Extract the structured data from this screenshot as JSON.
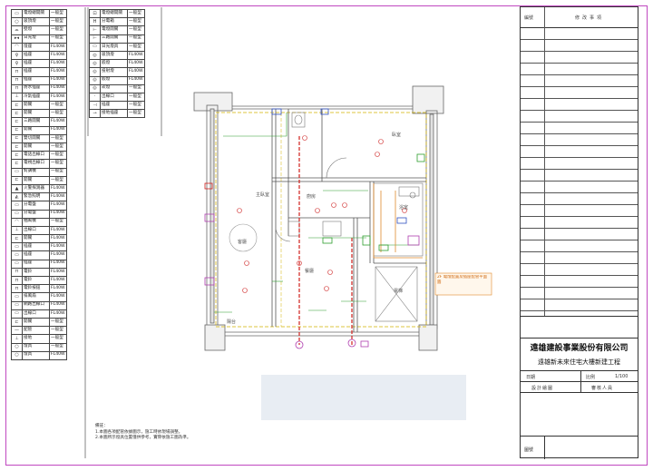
{
  "legend_left": [
    {
      "sym": "▭",
      "name": "電燈總開關",
      "spec": "一般型"
    },
    {
      "sym": "○",
      "name": "吸頂燈",
      "spec": "一般型"
    },
    {
      "sym": "⌓",
      "name": "壁燈",
      "spec": "一般型"
    },
    {
      "sym": "▸◂",
      "name": "日光燈",
      "spec": "一般型"
    },
    {
      "sym": "◠",
      "name": "燈座",
      "spec": "FL40W"
    },
    {
      "sym": "♀",
      "name": "插座",
      "spec": "FL40W"
    },
    {
      "sym": "♀",
      "name": "插座",
      "spec": "FL40W"
    },
    {
      "sym": "⊓",
      "name": "插座",
      "spec": "FL40W"
    },
    {
      "sym": "⊓",
      "name": "插座",
      "spec": "FL40W"
    },
    {
      "sym": "⊓",
      "name": "防水插座",
      "spec": "FL40W"
    },
    {
      "sym": "⊥",
      "name": "冷氣插座",
      "spec": "FL40W"
    },
    {
      "sym": "⊏",
      "name": "開關",
      "spec": "一般型"
    },
    {
      "sym": "⊏",
      "name": "開關",
      "spec": "一般型"
    },
    {
      "sym": "⊏",
      "name": "三路開關",
      "spec": "FL40W"
    },
    {
      "sym": "⊏",
      "name": "開關",
      "spec": "FL40W"
    },
    {
      "sym": "⊏",
      "name": "雙切開關",
      "spec": "一般型"
    },
    {
      "sym": "⊏",
      "name": "開關",
      "spec": "一般型"
    },
    {
      "sym": "⊏",
      "name": "電話出線口",
      "spec": "一般型"
    },
    {
      "sym": "⊏",
      "name": "電視出線口",
      "spec": "一般型"
    },
    {
      "sym": "▭",
      "name": "對講機",
      "spec": "一般型"
    },
    {
      "sym": "⊏",
      "name": "開關",
      "spec": "一般型"
    },
    {
      "sym": "▲",
      "name": "火警探測器",
      "spec": "FL40W"
    },
    {
      "sym": "◭",
      "name": "緊急照明",
      "spec": "FL40W"
    },
    {
      "sym": "▭",
      "name": "分電盤",
      "spec": "FL40W"
    },
    {
      "sym": "▭",
      "name": "分電盤",
      "spec": "FL40W"
    },
    {
      "sym": "◠",
      "name": "抽風機",
      "spec": "一般型"
    },
    {
      "sym": "⊥",
      "name": "出線口",
      "spec": "FL40W"
    },
    {
      "sym": "⊏",
      "name": "開關",
      "spec": "FL40W"
    },
    {
      "sym": "▭",
      "name": "插座",
      "spec": "FL40W"
    },
    {
      "sym": "▭",
      "name": "插座",
      "spec": "FL40W"
    },
    {
      "sym": "▭",
      "name": "插座",
      "spec": "FL40W"
    },
    {
      "sym": "⊓",
      "name": "電鈴",
      "spec": "FL40W"
    },
    {
      "sym": "⊓",
      "name": "電鈴",
      "spec": "FL40W"
    },
    {
      "sym": "⊓",
      "name": "電鈴按鈕",
      "spec": "FL40W"
    },
    {
      "sym": "▭",
      "name": "排風扇",
      "spec": "FL40W"
    },
    {
      "sym": "▭",
      "name": "網路出線口",
      "spec": "FL40W"
    },
    {
      "sym": "▭",
      "name": "出線口",
      "spec": "FL40W"
    },
    {
      "sym": "⊏",
      "name": "開關",
      "spec": "一般型"
    },
    {
      "sym": "—",
      "name": "配管",
      "spec": "一般型"
    },
    {
      "sym": "⊥",
      "name": "接地",
      "spec": "一般型"
    },
    {
      "sym": "○",
      "name": "燈具",
      "spec": "一般型"
    },
    {
      "sym": "○",
      "name": "燈具",
      "spec": "FL40W"
    }
  ],
  "legend_right": [
    {
      "sym": "⊡",
      "name": "電燈總開關",
      "spec": "一般型"
    },
    {
      "sym": "H",
      "name": "分電箱",
      "spec": "一般型"
    },
    {
      "sym": "⊢",
      "name": "電燈開關",
      "spec": "一般型"
    },
    {
      "sym": "⊢",
      "name": "三路開關",
      "spec": "一般型"
    },
    {
      "sym": "▭",
      "name": "日光燈具",
      "spec": "一般型"
    },
    {
      "sym": "◎",
      "name": "吸頂燈",
      "spec": "FL40W"
    },
    {
      "sym": "◎",
      "name": "嵌燈",
      "spec": "FL40W"
    },
    {
      "sym": "◎",
      "name": "投射燈",
      "spec": "FL40W"
    },
    {
      "sym": "◎",
      "name": "嵌燈",
      "spec": "FL40W"
    },
    {
      "sym": "◎",
      "name": "崁燈",
      "spec": "一般型"
    },
    {
      "sym": "·",
      "name": "出線口",
      "spec": "一般型"
    },
    {
      "sym": "⊣",
      "name": "插座",
      "spec": "一般型"
    },
    {
      "sym": "⊸",
      "name": "接地插座",
      "spec": "一般型"
    }
  ],
  "rooms": [
    "臥室",
    "主臥室",
    "廚房",
    "客廳",
    "餐廳",
    "浴室",
    "陽台",
    "電梯"
  ],
  "annotation": "2F 電燈配置及插座配管平面圖",
  "notes_title": "備註：",
  "notes": [
    "1.本圖各項配管依據圖示，施工時依現場調整。",
    "2.本圖所示燈具位置僅供參考，實際依施工圖為準。"
  ],
  "titleblock": {
    "rev_col1": "編號",
    "rev_col2": "修改事項",
    "company": "遠雄建設事業股份有限公司",
    "project": "遠雄新未來住宅大樓新建工程",
    "date_label": "日期",
    "scale_label": "比例",
    "scale_value": "1/100",
    "design_label": "設計繪圖",
    "check_label": "審核人員",
    "drawing_no_label": "圖號"
  }
}
